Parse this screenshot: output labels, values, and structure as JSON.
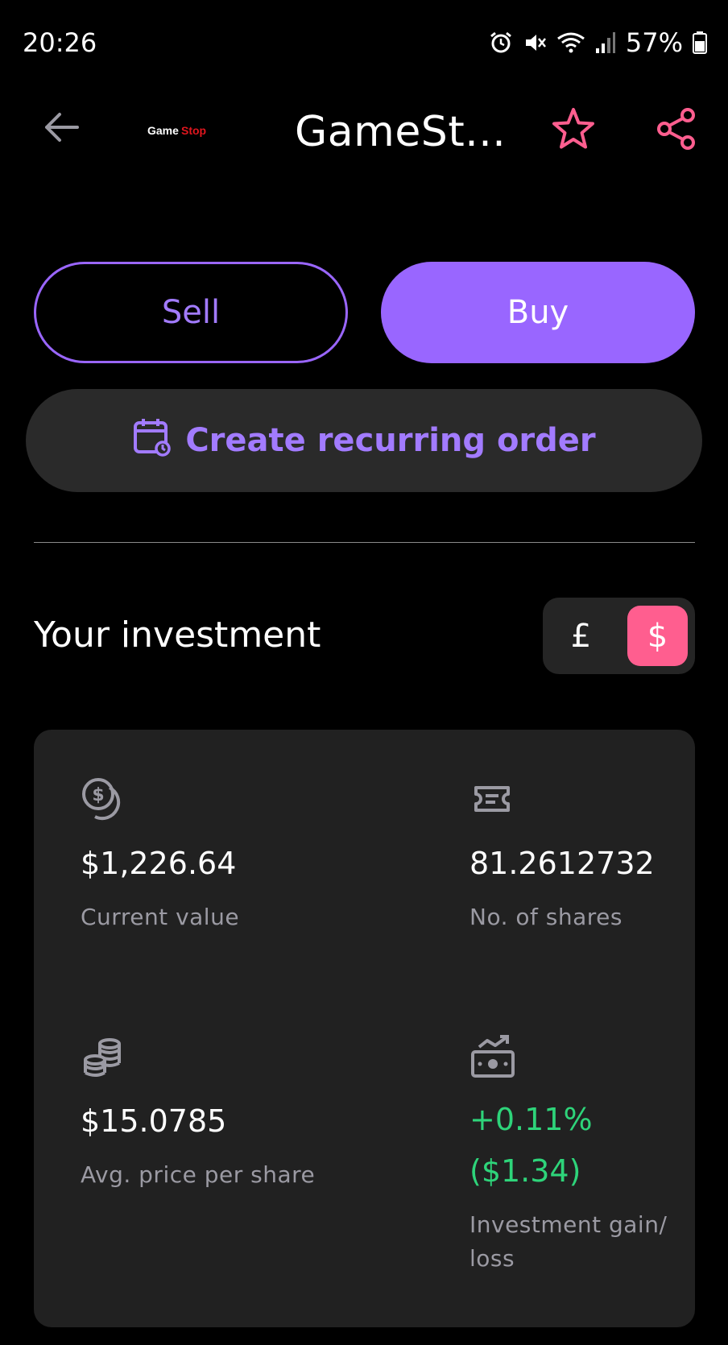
{
  "status_bar": {
    "time": "20:26",
    "battery": "57%"
  },
  "header": {
    "title": "GameSt...",
    "logo_text_a": "Game",
    "logo_text_b": "Stop"
  },
  "actions": {
    "sell_label": "Sell",
    "buy_label": "Buy",
    "recurring_label": "Create recurring order"
  },
  "investment": {
    "section_title": "Your investment",
    "currency_options": [
      "£",
      "$"
    ],
    "selected_currency": "$",
    "current_value": "$1,226.64",
    "current_value_label": "Current value",
    "shares": "81.2612732",
    "shares_label": "No. of shares",
    "avg_price": "$15.0785",
    "avg_price_label": "Avg. price per share",
    "gain_percent": "+0.11%",
    "gain_amount": "($1.34)",
    "gain_label": "Investment gain/ loss"
  },
  "colors": {
    "accent_purple": "#9966ff",
    "accent_pink": "#ff5e8f",
    "gain_green": "#2ed47a",
    "card_bg": "#212121"
  },
  "icons": [
    "back-arrow-icon",
    "star-icon",
    "share-icon",
    "calendar-repeat-icon",
    "coins-icon",
    "ticket-icon",
    "coin-stack-icon",
    "cash-growth-icon"
  ]
}
